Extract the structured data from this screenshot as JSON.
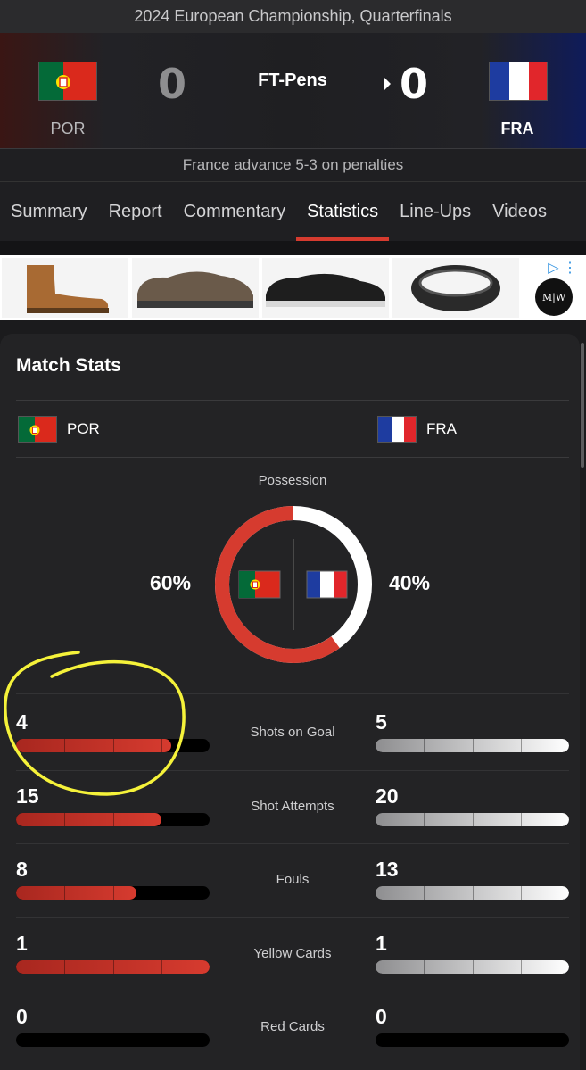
{
  "header": {
    "competition": "2024 European Championship, Quarterfinals",
    "status": "FT-Pens",
    "result_note": "France advance 5-3 on penalties"
  },
  "home": {
    "code": "POR",
    "score": "0",
    "flag": "portugal-flag"
  },
  "away": {
    "code": "FRA",
    "score": "0",
    "flag": "france-flag"
  },
  "tabs": [
    {
      "label": "Summary"
    },
    {
      "label": "Report"
    },
    {
      "label": "Commentary"
    },
    {
      "label": "Statistics",
      "active": true
    },
    {
      "label": "Line-Ups"
    },
    {
      "label": "Videos"
    }
  ],
  "stats": {
    "title": "Match Stats",
    "home_label": "POR",
    "away_label": "FRA",
    "possession": {
      "label": "Possession",
      "home_pct": "60%",
      "away_pct": "40%",
      "home_value": 60,
      "away_value": 40
    },
    "rows": [
      {
        "label": "Shots on Goal",
        "home": "4",
        "away": "5",
        "home_fill": 0.8,
        "away_fill": 1.0
      },
      {
        "label": "Shot Attempts",
        "home": "15",
        "away": "20",
        "home_fill": 0.75,
        "away_fill": 1.0
      },
      {
        "label": "Fouls",
        "home": "8",
        "away": "13",
        "home_fill": 0.62,
        "away_fill": 1.0
      },
      {
        "label": "Yellow Cards",
        "home": "1",
        "away": "1",
        "home_fill": 1.0,
        "away_fill": 1.0
      },
      {
        "label": "Red Cards",
        "home": "0",
        "away": "0",
        "home_fill": 0.0,
        "away_fill": 0.0
      }
    ]
  },
  "colors": {
    "home": "#d63b2f",
    "away": "#ffffff",
    "annotation": "#f5f23a"
  }
}
